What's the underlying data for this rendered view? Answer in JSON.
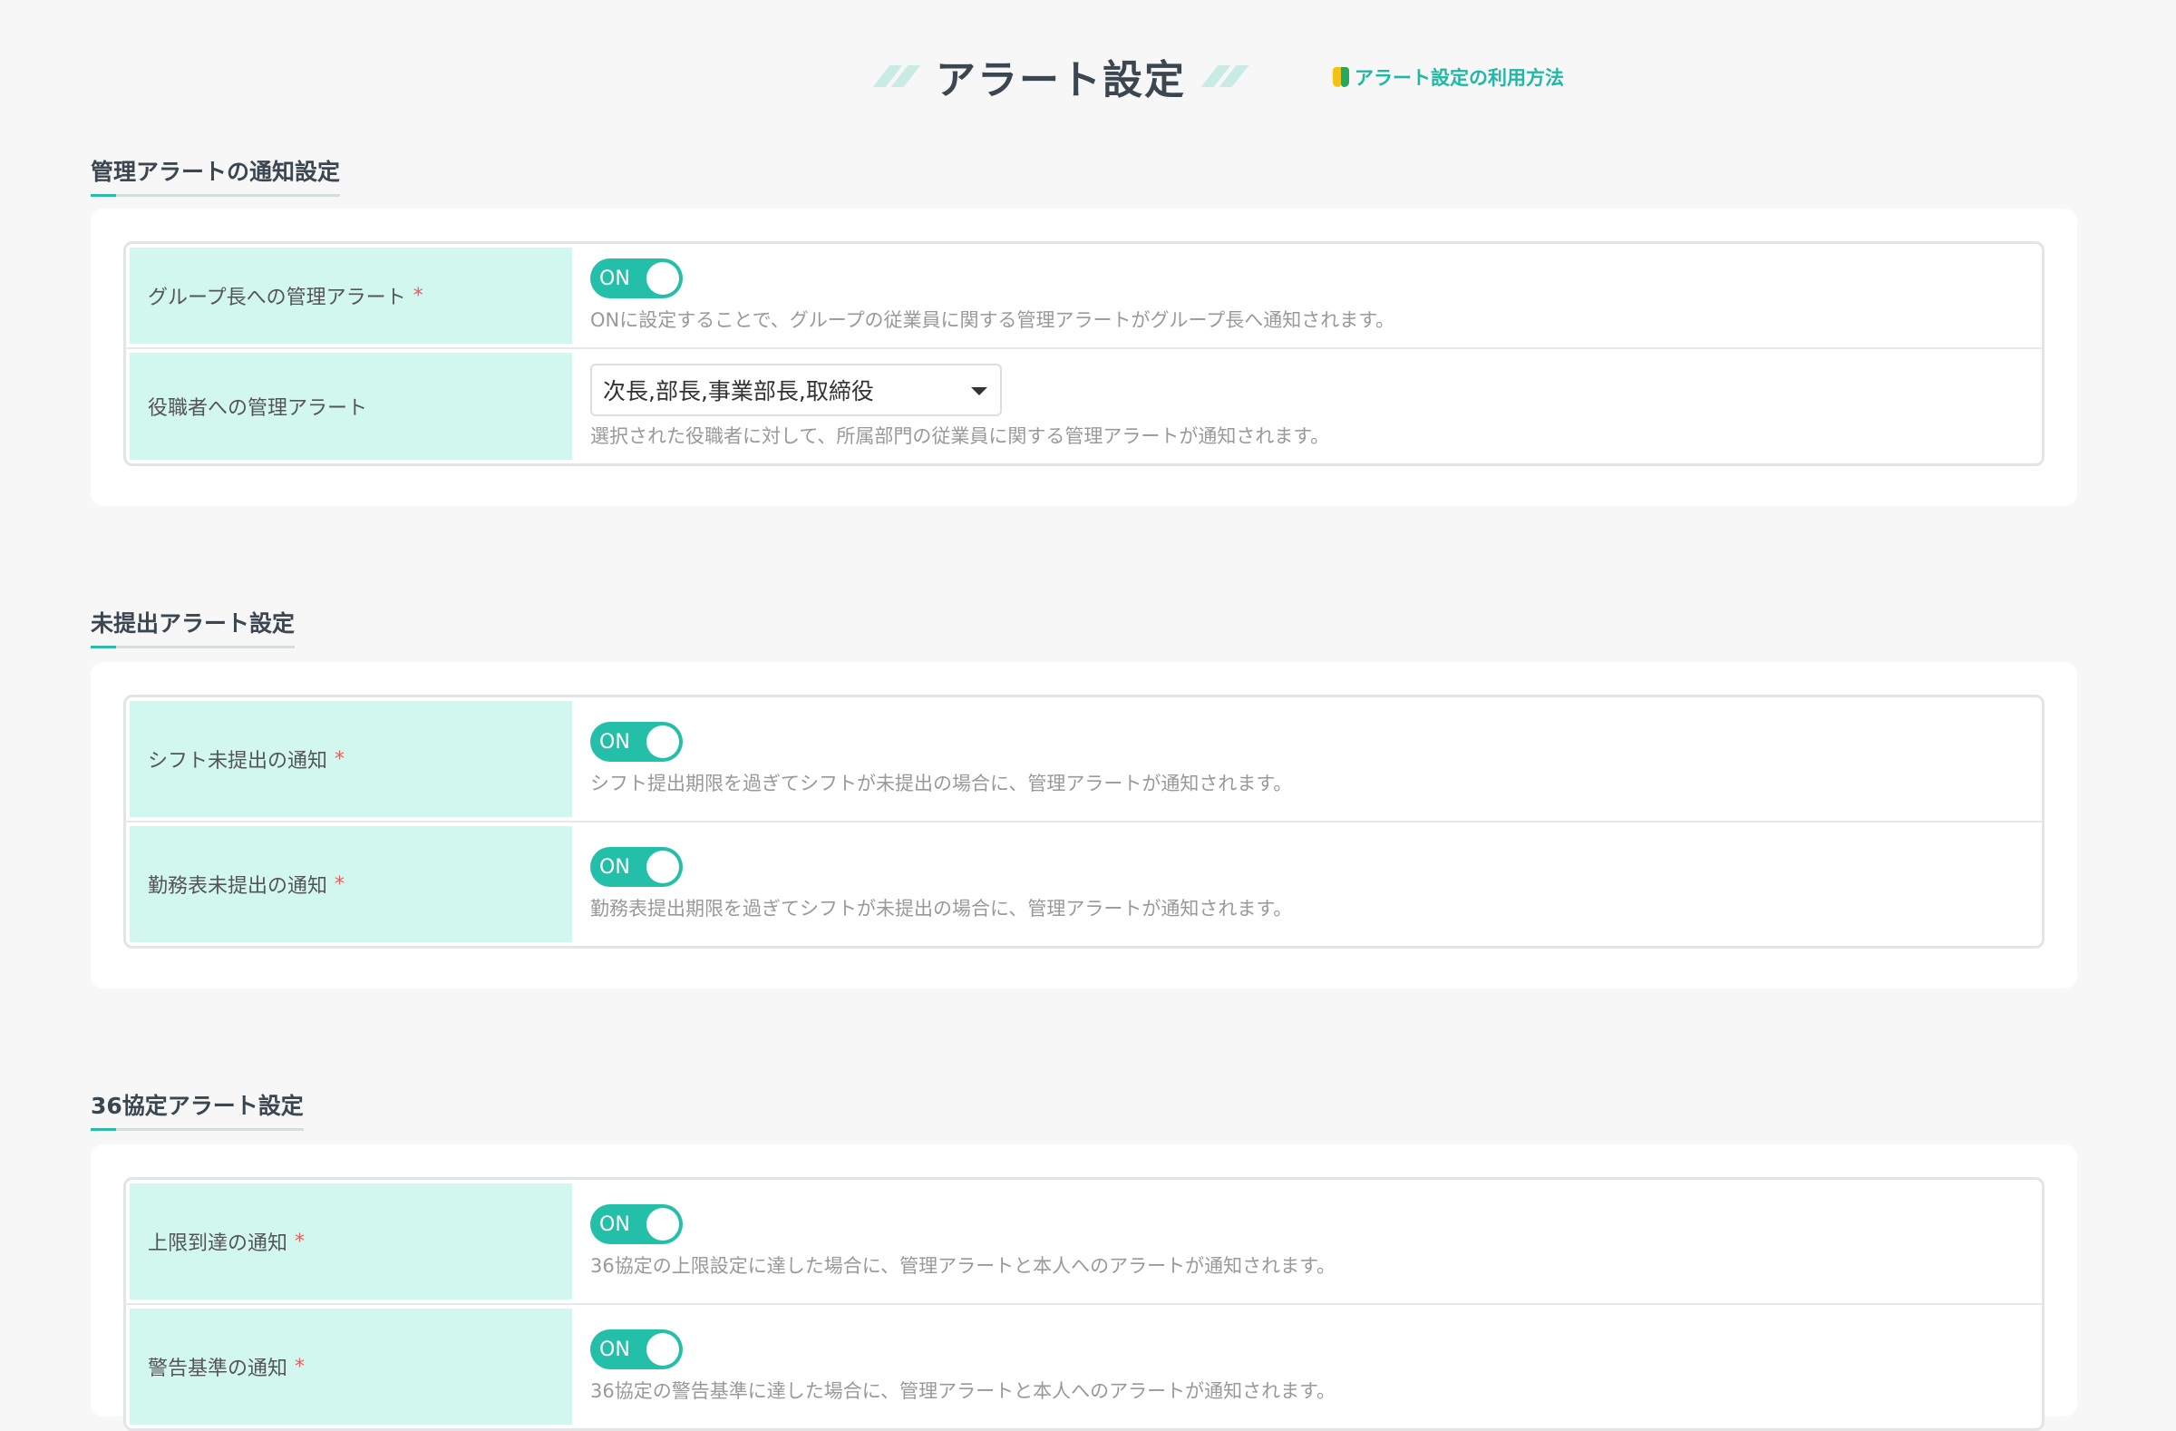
{
  "header": {
    "title": "アラート設定",
    "help_link": "アラート設定の利用方法",
    "help_icon": "beginner-leaf-icon"
  },
  "sections": [
    {
      "title": "管理アラートの通知設定",
      "rows": [
        {
          "label": "グループ長への管理アラート",
          "required": "*",
          "toggle": "ON",
          "description": "ONに設定することで、グループの従業員に関する管理アラートがグループ長へ通知されます。"
        },
        {
          "label": "役職者への管理アラート",
          "select_value": "次長,部長,事業部長,取締役",
          "description": "選択された役職者に対して、所属部門の従業員に関する管理アラートが通知されます。"
        }
      ]
    },
    {
      "title": "未提出アラート設定",
      "rows": [
        {
          "label": "シフト未提出の通知",
          "required": "*",
          "toggle": "ON",
          "description": "シフト提出期限を過ぎてシフトが未提出の場合に、管理アラートが通知されます。"
        },
        {
          "label": "勤務表未提出の通知",
          "required": "*",
          "toggle": "ON",
          "description": "勤務表提出期限を過ぎてシフトが未提出の場合に、管理アラートが通知されます。"
        }
      ]
    },
    {
      "title": "36協定アラート設定",
      "rows": [
        {
          "label": "上限到達の通知",
          "required": "*",
          "toggle": "ON",
          "description": "36協定の上限設定に達した場合に、管理アラートと本人へのアラートが通知されます。"
        },
        {
          "label": "警告基準の通知",
          "required": "*",
          "toggle": "ON",
          "description": "36協定の警告基準に達した場合に、管理アラートと本人へのアラートが通知されます。"
        }
      ]
    }
  ],
  "colors": {
    "accent": "#24bfa8",
    "label_bg": "#d2f7ef",
    "required": "#ef5a5a",
    "page_bg": "#f7f7f7"
  }
}
